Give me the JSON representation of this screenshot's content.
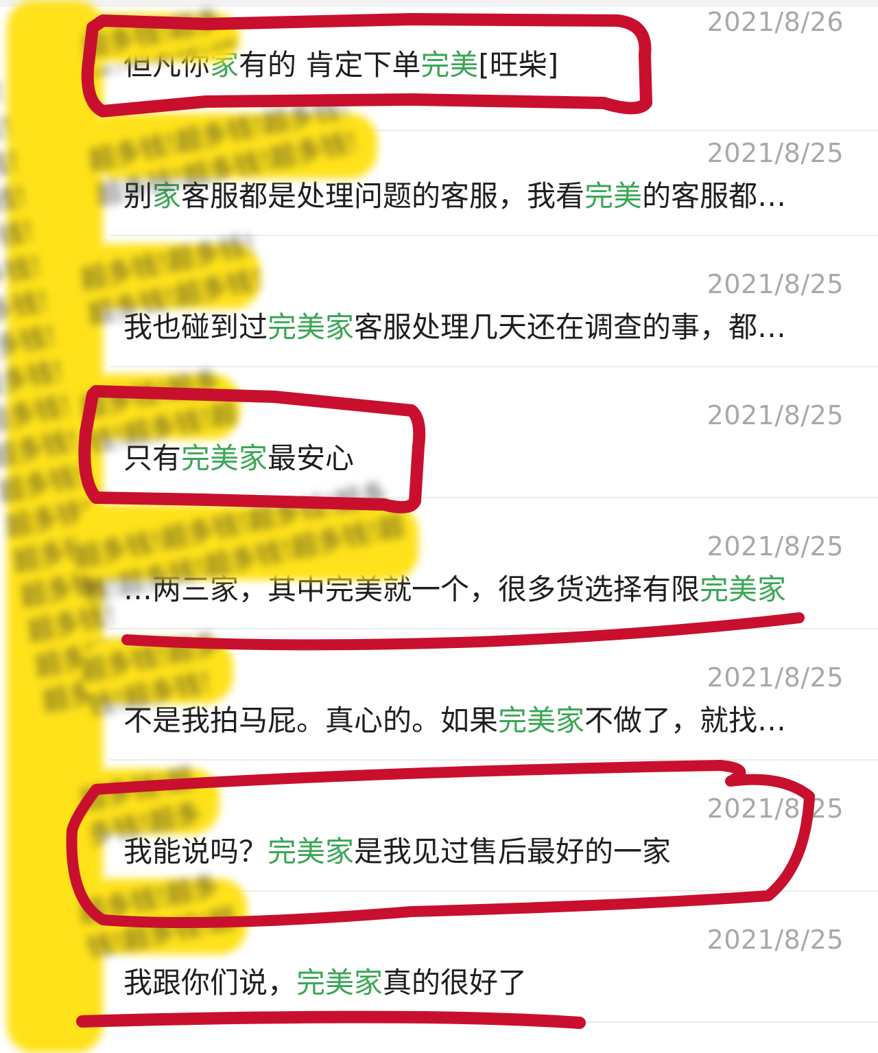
{
  "watermark": {
    "text": "超多钱!超多钱!超多钱!超多钱!超多钱!超多钱!超多钱!超多钱!超多钱!超多钱!超多钱!超多钱!超多钱!超多钱!超多钱!超多钱!超多钱!超多钱!超多钱!超多钱!"
  },
  "messages": [
    {
      "date": "2021/8/26",
      "parts": [
        "但凡你",
        "家",
        "有的 肯定下单",
        "完美",
        "[旺柴]"
      ]
    },
    {
      "date": "2021/8/25",
      "parts": [
        "别",
        "家",
        "客服都是处理问题的客服，我看",
        "完美",
        "的客服都…"
      ]
    },
    {
      "date": "2021/8/25",
      "parts": [
        "我也碰到过",
        "完美家",
        "客服处理几天还在调查的事，都…"
      ]
    },
    {
      "date": "2021/8/25",
      "parts": [
        "只有",
        "完美家",
        "最安心"
      ]
    },
    {
      "date": "2021/8/25",
      "parts": [
        "…两三家，其中完美就一个，很多货选择有限",
        "完美家",
        ""
      ]
    },
    {
      "date": "2021/8/25",
      "parts": [
        "不是我拍马屁。真心的。如果",
        "完美家",
        "不做了，就找…"
      ]
    },
    {
      "date": "2021/8/25",
      "parts": [
        "我能说吗？",
        "完美家",
        "是我见过售后最好的一家"
      ]
    },
    {
      "date": "2021/8/25",
      "parts": [
        "我跟你们说，",
        "完美家",
        "真的很好了"
      ]
    }
  ],
  "colors": {
    "highlight": "#3aa655",
    "annotation": "#c8102e",
    "redaction": "#ffe21a"
  }
}
